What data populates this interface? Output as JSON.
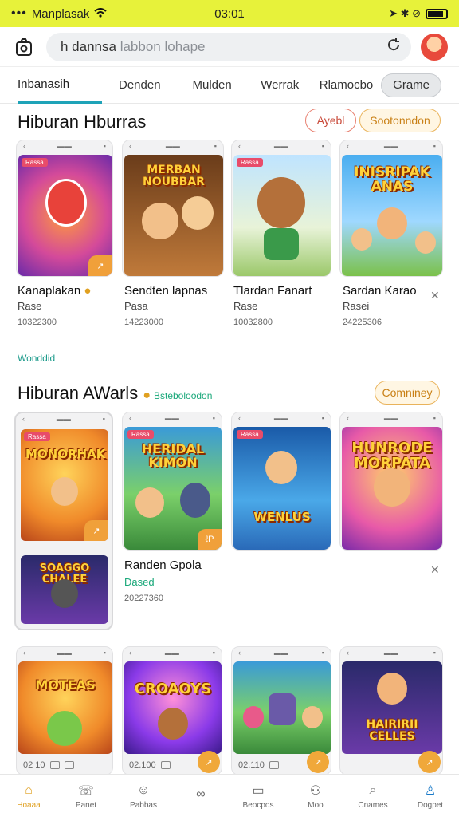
{
  "status": {
    "dots": "•••",
    "carrier": "Manplasak",
    "time": "03:01",
    "indicators": "➤ ✱ ⊘"
  },
  "search": {
    "value": "h dannsa",
    "placeholder": "labbon lohape"
  },
  "tabs": [
    "Inbanasih",
    "Denden",
    "Mulden",
    "Werrak",
    "Rlamocbo",
    "Grame"
  ],
  "section1": {
    "title": "Hiburan Hburras",
    "pill_red": "Ayebl",
    "pill_orange": "Sootonndon",
    "games": [
      {
        "thumb_tag": "Rassa",
        "thumb_title": "",
        "badge": "↗",
        "name": "Kanaplakan",
        "sub": "Rase",
        "count": "10322300",
        "color": "g-purple"
      },
      {
        "thumb_tag": "",
        "thumb_title": "MERBAN NOUBBAR",
        "badge": "",
        "name": "Sendten lapnas",
        "sub": "Pasa",
        "count": "14223000",
        "color": "g-brown"
      },
      {
        "thumb_tag": "Rassa",
        "thumb_title": "",
        "badge": "",
        "name": "Tlardan Fanart",
        "sub": "Rase",
        "count": "10032800",
        "color": "g-green"
      },
      {
        "thumb_tag": "",
        "thumb_title": "INISRIPAK ANAS",
        "badge": "",
        "name": "Sardan Karao",
        "sub": "Rasei",
        "count": "24225306",
        "color": "g-sky"
      }
    ]
  },
  "wonderful_link": "Wonddid",
  "section2": {
    "title": "Hiburan AWarls",
    "tag": "Bsteboloodon",
    "pill": "Comniney",
    "games": [
      {
        "thumb_tag": "Rassa",
        "thumb_title": "MONORHAK",
        "badge": "↗",
        "color": "g-orange"
      },
      {
        "thumb_tag": "Rassa",
        "thumb_title": "HERIDAL KIMON",
        "badge": "ℓP",
        "color": "g-jungle"
      },
      {
        "thumb_tag": "Rassa",
        "thumb_title": "WENLUS",
        "badge": "",
        "color": "g-blue"
      },
      {
        "thumb_tag": "",
        "thumb_title": "HUNRODE MORPATA",
        "badge": "",
        "color": "g-pink"
      }
    ],
    "extra_thumb_title": "SOAGGO CHALEE",
    "feature_name": "Randen Gpola",
    "feature_sub": "Dased",
    "feature_count": "20227360"
  },
  "section3": {
    "games": [
      {
        "thumb_title": "MOTEAS",
        "count": "02 10",
        "fab": "↗",
        "color": "g-orange"
      },
      {
        "thumb_title": "CROAOYS",
        "count": "02.100",
        "fab": "↗",
        "color": "g-violet"
      },
      {
        "thumb_title": "",
        "count": "02.110",
        "fab": "↗",
        "color": "g-jungle"
      },
      {
        "thumb_title": "HAIRIRII CELLES",
        "count": "",
        "fab": "↗",
        "color": "g-dark"
      }
    ]
  },
  "nav": [
    {
      "label": "Hoaaa",
      "icon": "⌂",
      "active": true
    },
    {
      "label": "Panet",
      "icon": "☏"
    },
    {
      "label": "Pabbas",
      "icon": "☺"
    },
    {
      "label": "",
      "icon": "∞"
    },
    {
      "label": "Beocpos",
      "icon": "▭"
    },
    {
      "label": "Moo",
      "icon": "⚇"
    },
    {
      "label": "Cnames",
      "icon": "⌕"
    },
    {
      "label": "Dogpet",
      "icon": "♙",
      "blue": true
    }
  ]
}
